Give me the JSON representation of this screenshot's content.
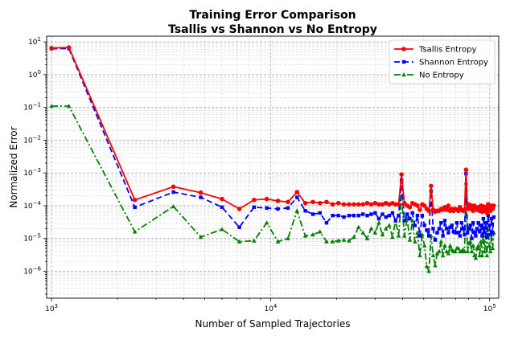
{
  "chart_data": {
    "type": "line",
    "title": "Training Error Comparison",
    "subtitle": "Tsallis vs Shannon vs No Entropy",
    "xlabel": "Number of Sampled Trajectories",
    "ylabel": "Normalized Error",
    "xscale": "log",
    "yscale": "log",
    "xlim": [
      950,
      110000
    ],
    "ylim": [
      1.5e-07,
      15
    ],
    "x_ticks": [
      {
        "value": 1000,
        "base": "10",
        "exp": "3"
      },
      {
        "value": 10000,
        "base": "10",
        "exp": "4"
      },
      {
        "value": 100000,
        "base": "10",
        "exp": "5"
      }
    ],
    "y_ticks": [
      {
        "value": 10,
        "base": "10",
        "exp": "1"
      },
      {
        "value": 1,
        "base": "10",
        "exp": "0"
      },
      {
        "value": 0.1,
        "base": "10",
        "exp": "−1"
      },
      {
        "value": 0.01,
        "base": "10",
        "exp": "−2"
      },
      {
        "value": 0.001,
        "base": "10",
        "exp": "−3"
      },
      {
        "value": 0.0001,
        "base": "10",
        "exp": "−4"
      },
      {
        "value": 1e-05,
        "base": "10",
        "exp": "−5"
      },
      {
        "value": 1e-06,
        "base": "10",
        "exp": "−6"
      }
    ],
    "grid": true,
    "legend_position": "top-right",
    "series": [
      {
        "name": "Tsallis Entropy",
        "color": "#ff0000",
        "dash": "",
        "marker": "circle",
        "x": [
          1000,
          1200,
          2400,
          3600,
          4800,
          6000,
          7200,
          8400,
          9600,
          10800,
          12000,
          13200,
          14400,
          15600,
          16800,
          18000,
          19200,
          20400,
          21600,
          22800,
          24000,
          25200,
          26400,
          27600,
          28800,
          30000,
          31200,
          32400,
          33600,
          34800,
          36000,
          37200,
          38400,
          39600,
          40800,
          42000,
          43200,
          44400,
          45600,
          46800,
          48000,
          49200,
          50400,
          51600,
          52800,
          54000,
          55200,
          56400,
          57600,
          58800,
          60000,
          61200,
          62400,
          63600,
          64800,
          66000,
          67200,
          68400,
          69600,
          70800,
          72000,
          73200,
          74400,
          75600,
          76800,
          78000,
          79200,
          80400,
          81600,
          82800,
          84000,
          85200,
          86400,
          87600,
          88800,
          90000,
          91200,
          92400,
          93600,
          94800,
          96000,
          97200,
          98400,
          99600,
          100800,
          102000,
          103200,
          104400
        ],
        "y": [
          6.5,
          6.8,
          0.00015,
          0.00038,
          0.00025,
          0.00016,
          8e-05,
          0.00015,
          0.00016,
          0.00014,
          0.00013,
          0.00026,
          0.00012,
          0.00013,
          0.00012,
          0.00013,
          0.00011,
          0.00012,
          0.00011,
          0.00011,
          0.00011,
          0.00011,
          0.00011,
          0.00012,
          0.00011,
          0.00012,
          0.00011,
          0.00011,
          0.00012,
          0.00011,
          0.00012,
          0.00011,
          0.00011,
          0.0009,
          0.00012,
          0.0001,
          9e-05,
          0.00012,
          0.00011,
          0.0001,
          7.5e-05,
          0.00011,
          0.0001,
          8e-05,
          7e-05,
          0.0004,
          7.5e-05,
          6.5e-05,
          7e-05,
          7e-05,
          8e-05,
          7.5e-05,
          9e-05,
          7.5e-05,
          0.0001,
          7e-05,
          8e-05,
          7e-05,
          8e-05,
          7.5e-05,
          7e-05,
          9e-05,
          7.5e-05,
          7e-05,
          7.5e-05,
          0.00125,
          8e-05,
          0.00011,
          8e-05,
          0.0001,
          7e-05,
          0.0001,
          8e-05,
          7.5e-05,
          9e-05,
          7e-05,
          0.0001,
          6.5e-05,
          9.5e-05,
          7e-05,
          9e-05,
          6e-05,
          0.00011,
          8e-05,
          7e-05,
          0.0001,
          8e-05,
          0.0001
        ]
      },
      {
        "name": "Shannon Entropy",
        "color": "#0000ff",
        "dash": "7,4",
        "marker": "square",
        "x": [
          1000,
          1200,
          2400,
          3600,
          4800,
          6000,
          7200,
          8400,
          9600,
          10800,
          12000,
          13200,
          14400,
          15600,
          16800,
          18000,
          19200,
          20400,
          21600,
          22800,
          24000,
          25200,
          26400,
          27600,
          28800,
          30000,
          31200,
          32400,
          33600,
          34800,
          36000,
          37200,
          38400,
          39600,
          40800,
          42000,
          43200,
          44400,
          45600,
          46800,
          48000,
          49200,
          50400,
          51600,
          52800,
          54000,
          55200,
          56400,
          57600,
          58800,
          60000,
          61200,
          62400,
          63600,
          64800,
          66000,
          67200,
          68400,
          69600,
          70800,
          72000,
          73200,
          74400,
          75600,
          76800,
          78000,
          79200,
          80400,
          81600,
          82800,
          84000,
          85200,
          86400,
          87600,
          88800,
          90000,
          91200,
          92400,
          93600,
          94800,
          96000,
          97200,
          98400,
          99600,
          100800,
          102000,
          103200,
          104400
        ],
        "y": [
          6.2,
          6.3,
          9e-05,
          0.00026,
          0.00018,
          9e-05,
          2.2e-05,
          9e-05,
          8.5e-05,
          8e-05,
          8.5e-05,
          0.00018,
          7e-05,
          5.5e-05,
          6e-05,
          3e-05,
          5e-05,
          5e-05,
          4.5e-05,
          5e-05,
          5e-05,
          5e-05,
          5.5e-05,
          5e-05,
          5.5e-05,
          6e-05,
          4e-05,
          5.5e-05,
          4.5e-05,
          5e-05,
          6e-05,
          3.5e-05,
          5e-05,
          0.0006,
          3.5e-05,
          5.5e-05,
          4e-05,
          6e-05,
          2.5e-05,
          5e-05,
          1.2e-05,
          5e-05,
          2.5e-05,
          1.8e-05,
          1.2e-05,
          0.00028,
          2e-05,
          9e-06,
          1.5e-05,
          2e-05,
          3e-05,
          1.2e-05,
          3.5e-05,
          2e-05,
          1.5e-05,
          2.2e-05,
          2.5e-05,
          1.6e-05,
          1.5e-05,
          3e-05,
          1.5e-05,
          1.2e-05,
          3e-05,
          2e-05,
          1.3e-05,
          0.00095,
          1.5e-05,
          2e-05,
          2.5e-05,
          1e-05,
          3e-05,
          1.5e-05,
          1.2e-05,
          2e-05,
          3e-05,
          1.6e-05,
          2.5e-05,
          1.2e-05,
          4e-05,
          1.5e-05,
          3e-05,
          1.1e-05,
          5e-05,
          2.5e-05,
          1.3e-05,
          4e-05,
          1.5e-05,
          4.5e-05
        ]
      },
      {
        "name": "No Entropy",
        "color": "#008000",
        "dash": "8,3,2,3",
        "marker": "triangle",
        "x": [
          1000,
          1200,
          2400,
          3600,
          4800,
          6000,
          7200,
          8400,
          9600,
          10800,
          12000,
          13200,
          14400,
          15600,
          16800,
          18000,
          19200,
          20400,
          21600,
          22800,
          24000,
          25200,
          26400,
          27600,
          28800,
          30000,
          31200,
          32400,
          33600,
          34800,
          36000,
          37200,
          38400,
          39600,
          40800,
          42000,
          43200,
          44400,
          45600,
          46800,
          48000,
          49200,
          50400,
          51600,
          52800,
          54000,
          55200,
          56400,
          57600,
          58800,
          60000,
          61200,
          62400,
          63600,
          64800,
          66000,
          67200,
          68400,
          69600,
          70800,
          72000,
          73200,
          74400,
          75600,
          76800,
          78000,
          79200,
          80400,
          81600,
          82800,
          84000,
          85200,
          86400,
          87600,
          88800,
          90000,
          91200,
          92400,
          93600,
          94800,
          96000,
          97200,
          98400,
          99600,
          100800,
          102000,
          103200,
          104400
        ],
        "y": [
          0.11,
          0.11,
          1.6e-05,
          9.5e-05,
          1.1e-05,
          1.9e-05,
          8e-06,
          8.5e-06,
          3e-05,
          8e-06,
          1e-05,
          7e-05,
          1.2e-05,
          1.3e-05,
          1.6e-05,
          8e-06,
          8e-06,
          8.5e-06,
          9e-06,
          8.5e-06,
          1.1e-05,
          2.2e-05,
          1.5e-05,
          1e-05,
          2e-05,
          1.5e-05,
          3e-05,
          1.3e-05,
          2e-05,
          2.5e-05,
          1.1e-05,
          3.5e-05,
          1.2e-05,
          0.0002,
          1.2e-05,
          4e-05,
          9e-06,
          3.5e-05,
          8e-06,
          1.5e-05,
          3e-06,
          1.3e-05,
          6e-06,
          1.4e-06,
          1e-06,
          1.2e-05,
          3e-06,
          1.5e-06,
          3.5e-06,
          4e-06,
          8e-06,
          3e-06,
          6e-06,
          4e-06,
          3.5e-06,
          6e-06,
          4.5e-06,
          4e-06,
          4e-06,
          5e-06,
          5e-06,
          4e-06,
          4e-06,
          4.5e-06,
          4e-06,
          0.0005,
          4e-06,
          7e-06,
          8e-06,
          4e-06,
          6e-06,
          3e-06,
          2.5e-06,
          5e-06,
          6e-06,
          3e-06,
          8e-06,
          3e-06,
          2e-05,
          4e-06,
          1.2e-05,
          3e-06,
          1.8e-05,
          6e-06,
          4e-06,
          1.5e-05,
          5e-06,
          1.5e-05
        ]
      }
    ]
  }
}
